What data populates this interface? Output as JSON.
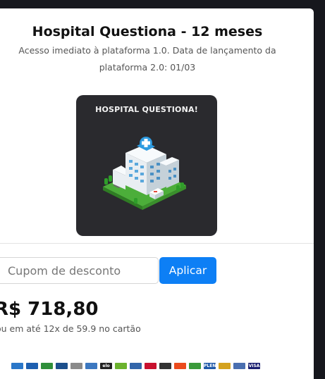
{
  "product": {
    "title": "Hospital Questiona - 12 meses",
    "subtitle": "Acesso imediato à plataforma 1.0. Data de lançamento da plataforma 2.0: 01/03",
    "image_caption": "HOSPITAL QUESTIONA!"
  },
  "coupon": {
    "placeholder": "Cupom de desconto",
    "value": "",
    "apply_label": "Aplicar"
  },
  "pricing": {
    "price": "R$ 718,80",
    "installments": "ou em até 12x de 59.9 no cartão"
  },
  "payment_methods": [
    {
      "name": "amex-icon",
      "color": "#2a77c9",
      "label": ""
    },
    {
      "name": "boleto-icon",
      "color": "#1d5fb0",
      "label": ""
    },
    {
      "name": "bank-icon",
      "color": "#2f8f3a",
      "label": ""
    },
    {
      "name": "bank-icon",
      "color": "#1c4f8c",
      "label": ""
    },
    {
      "name": "bank-icon",
      "color": "#8a8a8a",
      "label": ""
    },
    {
      "name": "bank-icon",
      "color": "#3c78c0",
      "label": ""
    },
    {
      "name": "elo-icon",
      "color": "#222222",
      "label": "elo"
    },
    {
      "name": "card-icon",
      "color": "#6bb22e",
      "label": ""
    },
    {
      "name": "card-icon",
      "color": "#3366aa",
      "label": ""
    },
    {
      "name": "hipercard-icon",
      "color": "#c8102e",
      "label": ""
    },
    {
      "name": "card-icon",
      "color": "#333333",
      "label": ""
    },
    {
      "name": "mastercard-icon",
      "color": "#eb4a1c",
      "label": ""
    },
    {
      "name": "card-icon",
      "color": "#3a9a3a",
      "label": ""
    },
    {
      "name": "pleno-icon",
      "color": "#1f58a8",
      "label": "PLENO"
    },
    {
      "name": "card-icon",
      "color": "#d4a21e",
      "label": ""
    },
    {
      "name": "card-icon",
      "color": "#4a6fb0",
      "label": ""
    },
    {
      "name": "visa-icon",
      "color": "#1a1f71",
      "label": "VISA"
    }
  ]
}
